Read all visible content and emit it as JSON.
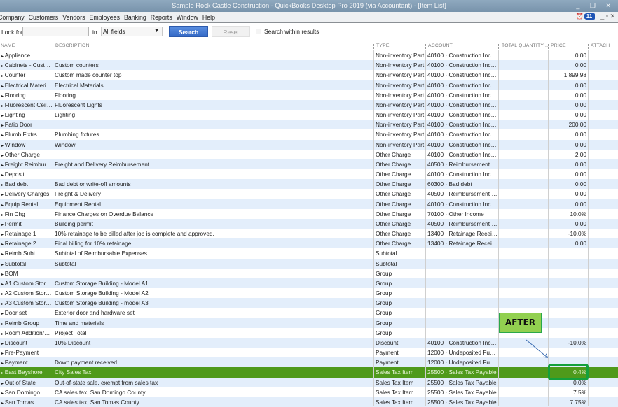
{
  "window": {
    "title": "Sample Rock Castle Construction  - QuickBooks Desktop Pro 2019 (via Accountant)  - [Item List]",
    "controls": "_ ❐ ✕"
  },
  "menu": [
    "Company",
    "Customers",
    "Vendors",
    "Employees",
    "Banking",
    "Reports",
    "Window",
    "Help"
  ],
  "reminders_count": "11",
  "menu_controls": "_ ▫ ✕",
  "search": {
    "look_for_label": "Look for",
    "look_for_value": "",
    "in_label": "in",
    "field_value": "All fields",
    "search_label": "Search",
    "reset_label": "Reset",
    "within_label": "Search within results"
  },
  "columns": [
    "NAME",
    "DESCRIPTION",
    "TYPE",
    "ACCOUNT",
    "TOTAL QUANTITY ...",
    "PRICE",
    "ATTACH"
  ],
  "rows": [
    [
      "Appliance",
      "",
      "Non-inventory Part",
      "40100 · Construction Incom...",
      "",
      "0.00"
    ],
    [
      "Cabinets - Custom",
      "Custom counters",
      "Non-inventory Part",
      "40100 · Construction Incom...",
      "",
      "0.00"
    ],
    [
      "Counter",
      "Custom made counter top",
      "Non-inventory Part",
      "40100 · Construction Incom...",
      "",
      "1,899.98"
    ],
    [
      "Electrical Materials",
      "Electrical Materials",
      "Non-inventory Part",
      "40100 · Construction Incom...",
      "",
      "0.00"
    ],
    [
      "Flooring",
      "Flooring",
      "Non-inventory Part",
      "40100 · Construction Incom...",
      "",
      "0.00"
    ],
    [
      "Fluorescent Ceilin...",
      "Fluorescent Lights",
      "Non-inventory Part",
      "40100 · Construction Incom...",
      "",
      "0.00"
    ],
    [
      "Lighting",
      "Lighting",
      "Non-inventory Part",
      "40100 · Construction Incom...",
      "",
      "0.00"
    ],
    [
      "Patio Door",
      "",
      "Non-inventory Part",
      "40100 · Construction Incom...",
      "",
      "200.00"
    ],
    [
      "Plumb Fixtrs",
      "Plumbing fixtures",
      "Non-inventory Part",
      "40100 · Construction Incom...",
      "",
      "0.00"
    ],
    [
      "Window",
      "Window",
      "Non-inventory Part",
      "40100 · Construction Incom...",
      "",
      "0.00"
    ],
    [
      "Other Charge",
      "",
      "Other Charge",
      "40100 · Construction Income",
      "",
      "2.00"
    ],
    [
      "Freight Reimburse...",
      "Freight and Delivery Reimbursement",
      "Other Charge",
      "40500 · Reimbursement Inc...",
      "",
      "0.00"
    ],
    [
      "Deposit",
      "",
      "Other Charge",
      "40100 · Construction Incom...",
      "",
      "0.00"
    ],
    [
      "Bad debt",
      "Bad debt or write-off amounts",
      "Other Charge",
      "60300 · Bad debt",
      "",
      "0.00"
    ],
    [
      "Delivery Charges",
      "Freight & Delivery",
      "Other Charge",
      "40500 · Reimbursement Inc...",
      "",
      "0.00"
    ],
    [
      "Equip Rental",
      "Equipment Rental",
      "Other Charge",
      "40100 · Construction Incom...",
      "",
      "0.00"
    ],
    [
      "Fin Chg",
      "Finance Charges on Overdue Balance",
      "Other Charge",
      "70100 · Other Income",
      "",
      "10.0%"
    ],
    [
      "Permit",
      "Building permit",
      "Other Charge",
      "40500 · Reimbursement Inc...",
      "",
      "0.00"
    ],
    [
      "Retainage 1",
      "10% retainage to be billed after job is complete and approved.",
      "Other Charge",
      "13400 · Retainage Receiva...",
      "",
      "-10.0%"
    ],
    [
      "Retainage 2",
      "Final billing for 10% retainage",
      "Other Charge",
      "13400 · Retainage Receiva...",
      "",
      "0.00"
    ],
    [
      "Reimb Subt",
      "Subtotal of Reimbursable Expenses",
      "Subtotal",
      "",
      "",
      ""
    ],
    [
      "Subtotal",
      "Subtotal",
      "Subtotal",
      "",
      "",
      ""
    ],
    [
      "BOM",
      "",
      "Group",
      "",
      "",
      ""
    ],
    [
      "A1 Custom Storag...",
      "Custom Storage Building - Model A1",
      "Group",
      "",
      "",
      ""
    ],
    [
      "A2 Custom Storag...",
      "Custom Storage Building - Model A2",
      "Group",
      "",
      "",
      ""
    ],
    [
      "A3 Custom Storag...",
      "Custom Storage Building - model A3",
      "Group",
      "",
      "",
      ""
    ],
    [
      "Door set",
      "Exterior door and hardware set",
      "Group",
      "",
      "",
      ""
    ],
    [
      "Reimb Group",
      "Time and materials",
      "Group",
      "",
      "",
      ""
    ],
    [
      "Room Addition/Re...",
      "Project Total",
      "Group",
      "",
      "",
      ""
    ],
    [
      "Discount",
      "10% Discount",
      "Discount",
      "40100 · Construction Incom...",
      "",
      "-10.0%"
    ],
    [
      "Pre-Payment",
      "",
      "Payment",
      "12000 · Undeposited Funds",
      "",
      ""
    ],
    [
      "Payment",
      "Down payment received",
      "Payment",
      "12000 · Undeposited Funds",
      "",
      ""
    ],
    [
      "East Bayshore",
      "City Sales Tax",
      "Sales Tax Item",
      "25500 · Sales Tax Payable",
      "",
      "0.4%"
    ],
    [
      "Out of State",
      "Out-of-state sale, exempt from sales tax",
      "Sales Tax Item",
      "25500 · Sales Tax Payable",
      "",
      "0.0%"
    ],
    [
      "San Domingo",
      "CA sales tax, San Domingo County",
      "Sales Tax Item",
      "25500 · Sales Tax Payable",
      "",
      "7.5%"
    ],
    [
      "San Tomas",
      "CA sales tax, San Tomas County",
      "Sales Tax Item",
      "25500 · Sales Tax Payable",
      "",
      "7.75%"
    ]
  ],
  "selected_row": 32,
  "annotation": {
    "label": "AFTER",
    "box_color": "#92d050",
    "highlight_color": "#14a03c"
  },
  "colors": {
    "selected": "#4f9a1b",
    "alt_row": "#e3eefb",
    "search_btn": "#3469c6"
  }
}
